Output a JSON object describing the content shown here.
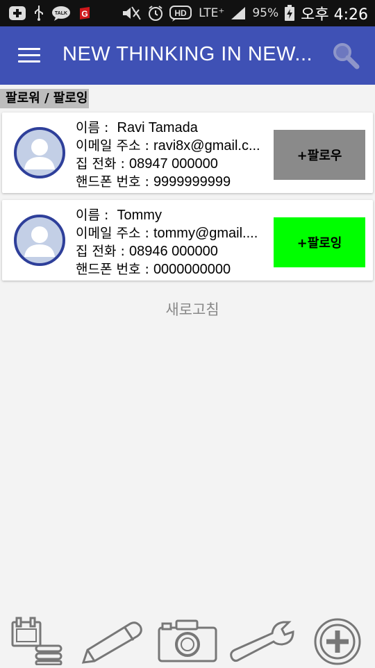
{
  "status_bar": {
    "talk_label": "TALK",
    "hd_label": "HD",
    "lte_label": "LTE⁺",
    "battery": "95%",
    "time": "오후 4:26"
  },
  "app_bar": {
    "title": "NEW THINKING IN NEW...",
    "menu_icon": "hamburger-menu-icon",
    "search_icon": "search-icon",
    "color": "#3f51b5"
  },
  "section": {
    "label": "팔로워 / 팔로잉"
  },
  "contacts": [
    {
      "name_label": "이름 :",
      "name": "Ravi Tamada",
      "email_label": "이메일 주소 :",
      "email": "ravi8x@gmail.c...",
      "home_label": "집 전화 :",
      "home": "08947 000000",
      "mobile_label": "핸드폰 번호 :",
      "mobile": "9999999999",
      "button": "+팔로우",
      "button_color": "#8a8a8a"
    },
    {
      "name_label": "이름 :",
      "name": "Tommy",
      "email_label": "이메일 주소 :",
      "email": "tommy@gmail....",
      "home_label": "집 전화 :",
      "home": "08946 000000",
      "mobile_label": "핸드폰 번호 :",
      "mobile": "0000000000",
      "button": "+팔로잉",
      "button_color": "#00ff00"
    }
  ],
  "refresh_label": "새로고침",
  "bottom_nav": [
    "calendar-list-icon",
    "pencil-icon",
    "camera-icon",
    "wrench-icon",
    "add-circle-icon"
  ]
}
